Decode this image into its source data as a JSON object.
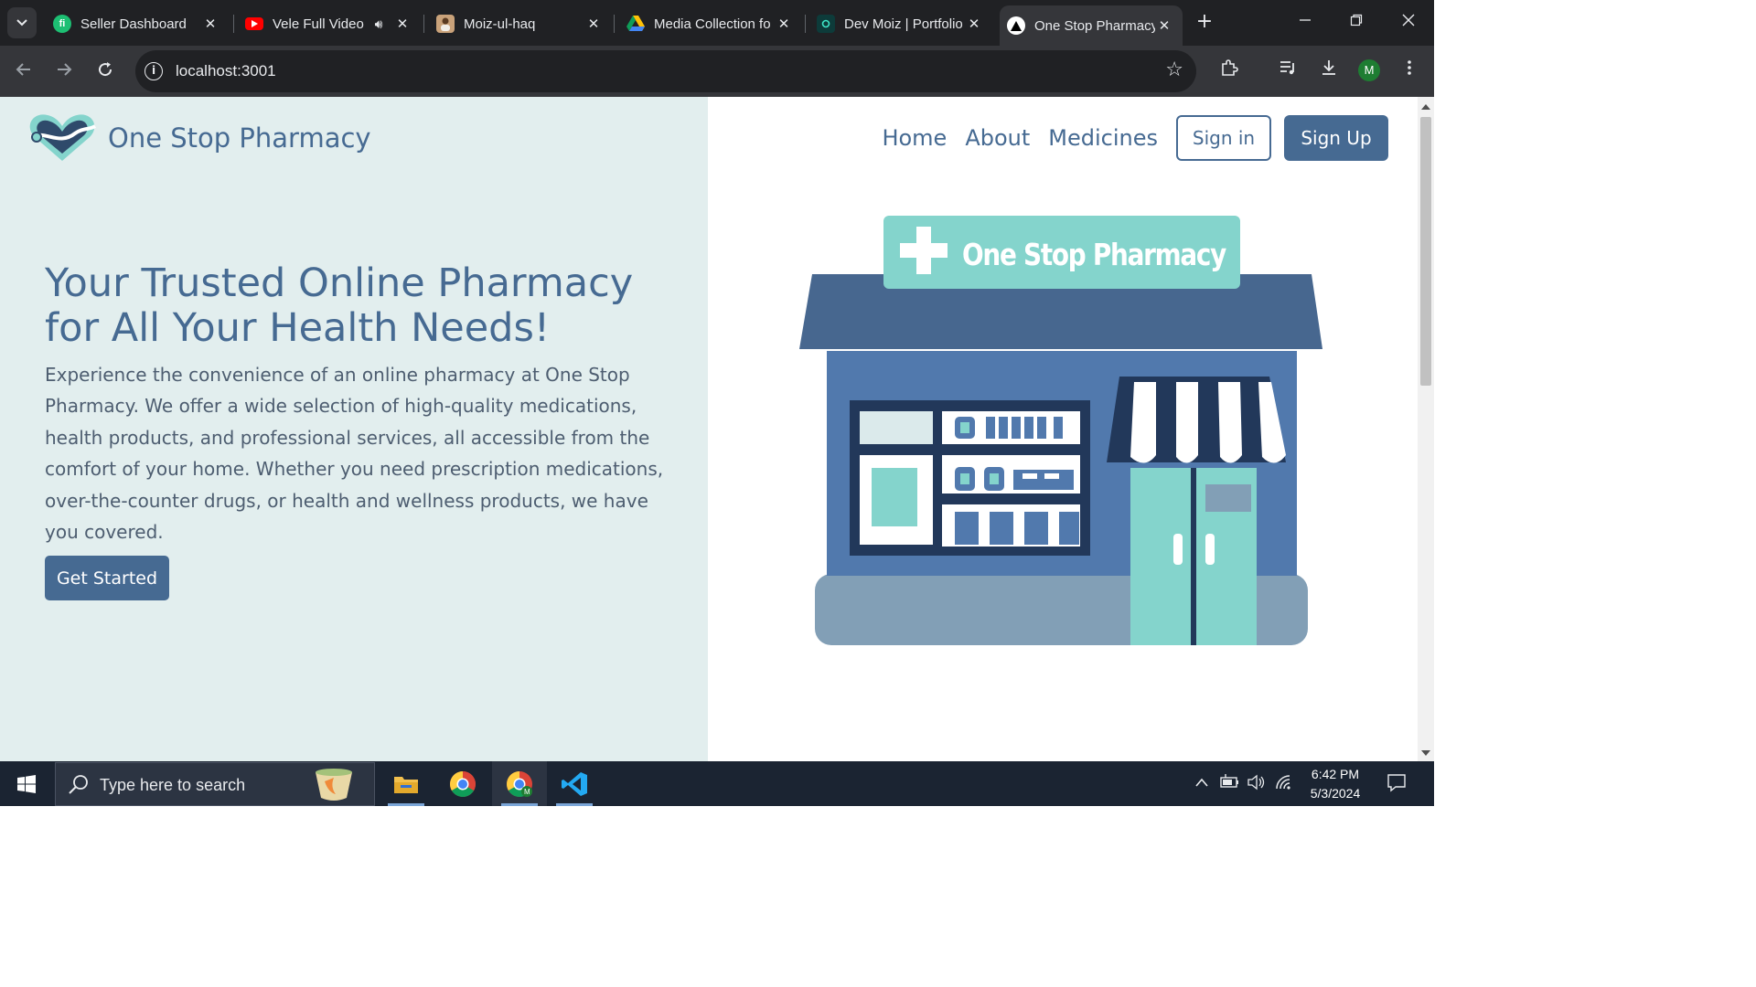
{
  "browser": {
    "tabs": [
      {
        "title": "Seller Dashboard",
        "icon": "fiverr-icon",
        "active": false
      },
      {
        "title": "Vele Full Video",
        "icon": "youtube-icon",
        "active": false,
        "audio": true
      },
      {
        "title": "Moiz-ul-haq",
        "icon": "profile-photo-icon",
        "active": false
      },
      {
        "title": "Media Collection fo",
        "icon": "google-drive-icon",
        "active": false
      },
      {
        "title": "Dev Moiz | Portfolio",
        "icon": "portfolio-icon",
        "active": false
      },
      {
        "title": "One Stop Pharmacy",
        "icon": "nextjs-icon",
        "active": true
      }
    ],
    "url": "localhost:3001",
    "profile_initial": "M"
  },
  "site": {
    "brand_name": "One Stop Pharmacy",
    "nav": {
      "home": "Home",
      "about": "About",
      "medicines": "Medicines",
      "sign_in": "Sign in",
      "sign_up": "Sign Up"
    },
    "hero": {
      "title": "Your Trusted Online Pharmacy for All Your Health Needs!",
      "text": "Experience the convenience of an online pharmacy at One Stop Pharmacy. We offer a wide selection of high-quality medications, health products, and professional services, all accessible from the comfort of your home. Whether you need prescription medications, over-the-counter drugs, or health and wellness products, we have you covered.",
      "cta": "Get Started"
    },
    "store_sign": "One Stop Pharmacy",
    "colors": {
      "primary": "#466a92",
      "panel_bg": "#e2eeee",
      "teal": "#84d4cc"
    }
  },
  "taskbar": {
    "search_placeholder": "Type here to search",
    "time": "6:42 PM",
    "date": "5/3/2024"
  }
}
